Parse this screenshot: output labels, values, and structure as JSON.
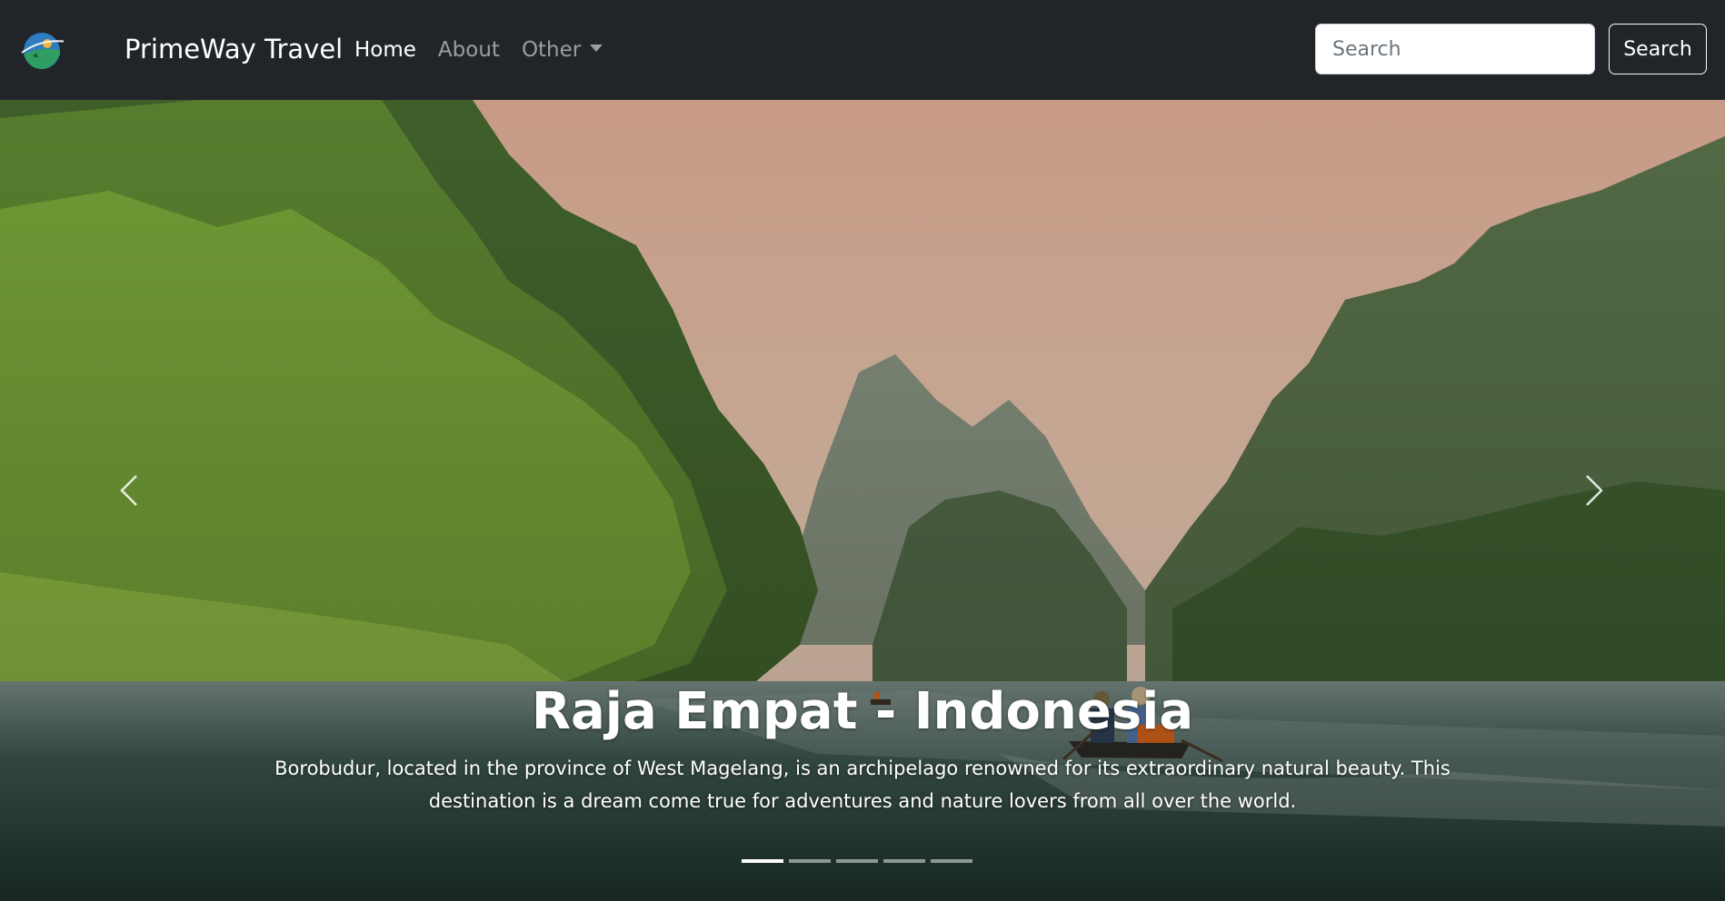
{
  "navbar": {
    "brand": "PrimeWay Travel",
    "links": [
      {
        "label": "Home",
        "active": true
      },
      {
        "label": "About",
        "active": false
      },
      {
        "label": "Other",
        "dropdown": true
      }
    ],
    "search": {
      "placeholder": "Search",
      "button_label": "Search"
    }
  },
  "carousel": {
    "slide": {
      "title": "Raja Empat - Indonesia",
      "text": "Borobudur, located in the province of West Magelang, is an archipelago renowned for its extraordinary natural beauty. This destination is a dream come true for adventures and nature lovers from all over the world."
    },
    "controls": {
      "prev_icon": "chevron-left-icon",
      "next_icon": "chevron-right-icon"
    },
    "indicators_count": 5,
    "active_indicator": 1
  },
  "colors": {
    "navbar_bg": "#212529",
    "text_light": "#ffffff",
    "text_muted": "rgba(255,255,255,0.55)"
  }
}
